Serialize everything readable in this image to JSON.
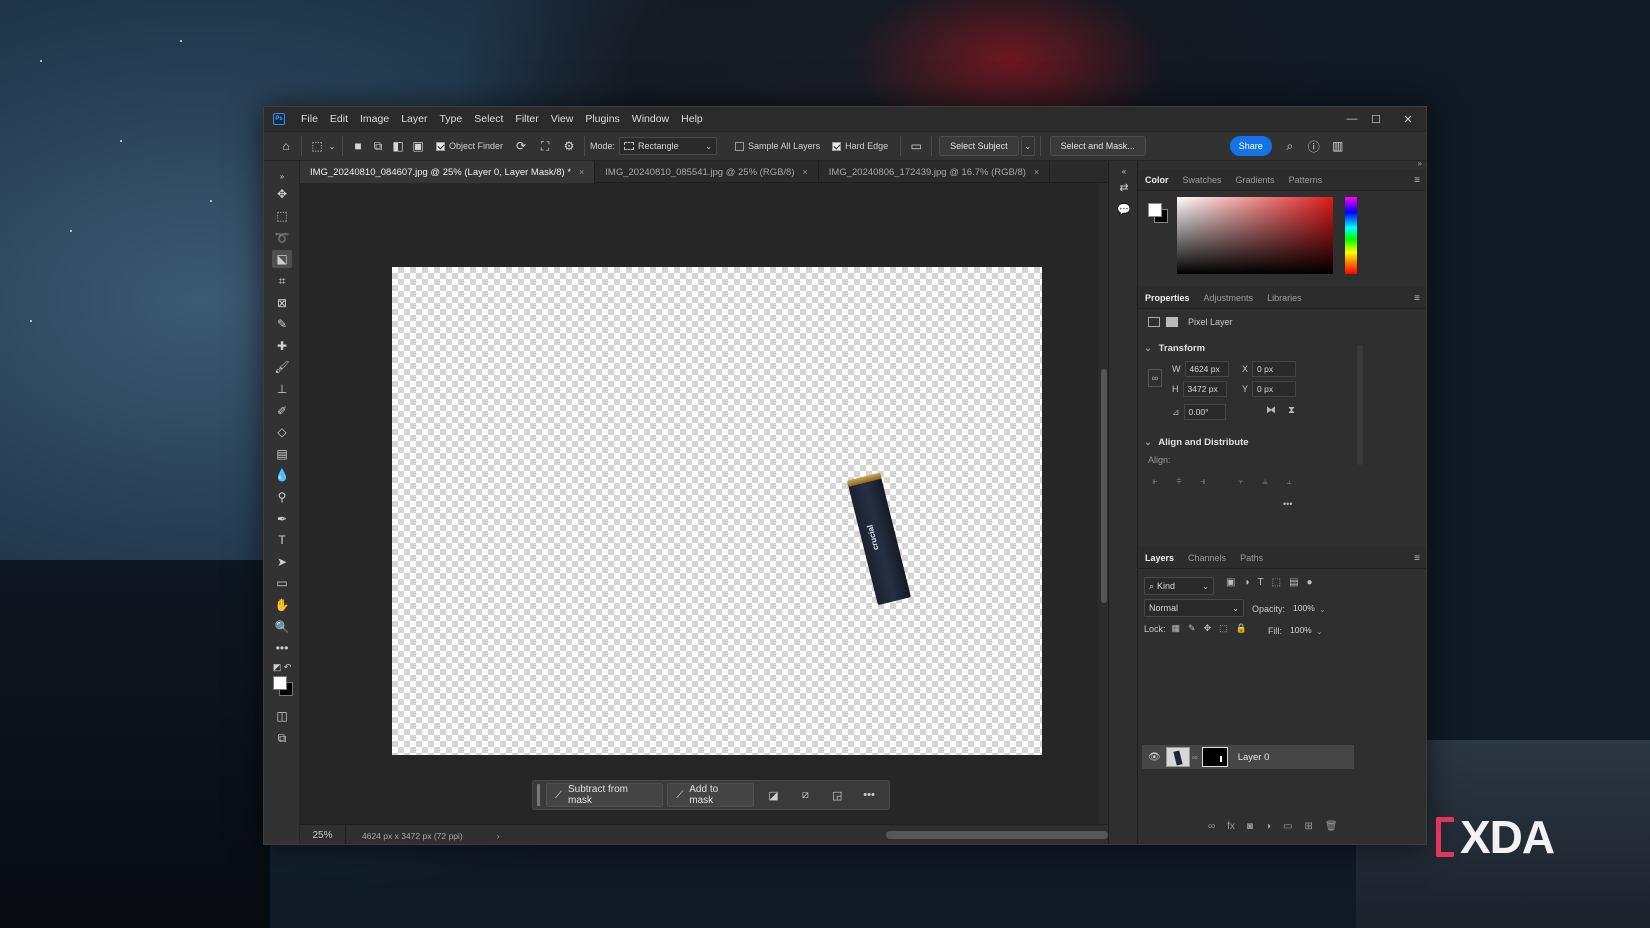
{
  "app": {
    "logo": "Ps",
    "menu": [
      "File",
      "Edit",
      "Image",
      "Layer",
      "Type",
      "Select",
      "Filter",
      "View",
      "Plugins",
      "Window",
      "Help"
    ]
  },
  "options": {
    "object_finder": "Object Finder",
    "mode_label": "Mode:",
    "mode_value": "Rectangle",
    "sample_all_layers": "Sample All Layers",
    "hard_edge": "Hard Edge",
    "select_subject": "Select Subject",
    "select_and_mask": "Select and Mask...",
    "share": "Share"
  },
  "tabs": [
    {
      "label": "IMG_20240810_084607.jpg @ 25% (Layer 0, Layer Mask/8) *",
      "close": "×"
    },
    {
      "label": "IMG_20240810_085541.jpg @ 25% (RGB/8)",
      "close": "×"
    },
    {
      "label": "IMG_20240806_172439.jpg @ 16.7% (RGB/8)",
      "close": "×"
    }
  ],
  "canvas": {
    "ssd_brand": "crucial"
  },
  "context_bar": {
    "subtract": "Subtract from mask",
    "add": "Add to mask",
    "more": "•••"
  },
  "status": {
    "zoom": "25%",
    "info": "4624 px x 3472 px (72 ppi)",
    "arrow": "›"
  },
  "color_panel": {
    "tabs": [
      "Color",
      "Swatches",
      "Gradients",
      "Patterns"
    ]
  },
  "properties_panel": {
    "tabs": [
      "Properties",
      "Adjustments",
      "Libraries"
    ],
    "layer_type": "Pixel Layer",
    "transform_title": "Transform",
    "w_label": "W",
    "w_value": "4624 px",
    "h_label": "H",
    "h_value": "3472 px",
    "x_label": "X",
    "x_value": "0 px",
    "y_label": "Y",
    "y_value": "0 px",
    "angle_value": "0.00°",
    "align_title": "Align and Distribute",
    "align_label": "Align:",
    "more": "•••"
  },
  "layers_panel": {
    "tabs": [
      "Layers",
      "Channels",
      "Paths"
    ],
    "kind": "Kind",
    "blend_mode": "Normal",
    "opacity_label": "Opacity:",
    "opacity_value": "100%",
    "lock_label": "Lock:",
    "fill_label": "Fill:",
    "fill_value": "100%",
    "layer_name": "Layer 0"
  },
  "watermark": {
    "text": "XDA"
  },
  "colors": {
    "accent": "#1473e6",
    "active_layer": "#464646"
  }
}
